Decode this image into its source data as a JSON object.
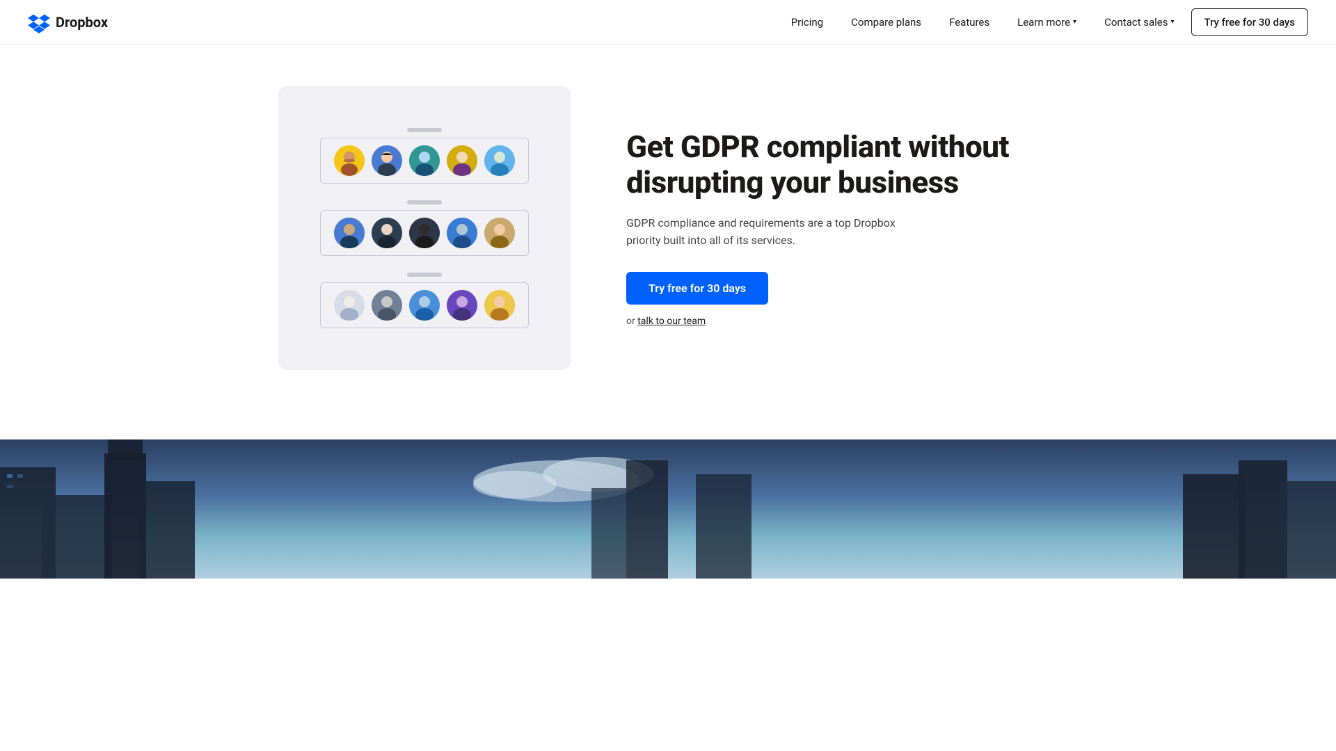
{
  "logo": {
    "text": "Dropbox",
    "alt": "Dropbox logo"
  },
  "nav": {
    "links": [
      {
        "id": "pricing",
        "label": "Pricing",
        "hasDropdown": false
      },
      {
        "id": "compare-plans",
        "label": "Compare plans",
        "hasDropdown": false
      },
      {
        "id": "features",
        "label": "Features",
        "hasDropdown": false
      },
      {
        "id": "learn-more",
        "label": "Learn more",
        "hasDropdown": true
      },
      {
        "id": "contact-sales",
        "label": "Contact sales",
        "hasDropdown": true
      }
    ],
    "cta": "Try free for 30 days"
  },
  "hero": {
    "title": "Get GDPR compliant without disrupting your business",
    "description": "GDPR compliance and requirements are a top Dropbox priority built into all of its services.",
    "cta_primary": "Try free for 30 days",
    "cta_secondary_prefix": "or",
    "cta_secondary_link": "talk to our team"
  },
  "avatar_rows": [
    {
      "colors": [
        "yellow",
        "blue-dark",
        "teal",
        "gold",
        "light-blue"
      ]
    },
    {
      "colors": [
        "navy",
        "dark",
        "black",
        "blue",
        "brown"
      ]
    },
    {
      "colors": [
        "light-gray",
        "slate",
        "blue-med",
        "purple",
        "yellow2"
      ]
    }
  ]
}
